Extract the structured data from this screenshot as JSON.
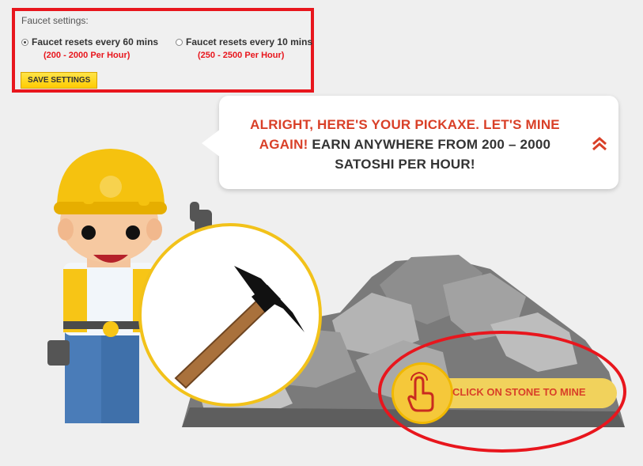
{
  "settings": {
    "title": "Faucet settings:",
    "option1": {
      "label": "Faucet resets every 60 mins",
      "rate": "(200 - 2000 Per Hour)",
      "selected": true
    },
    "option2": {
      "label": "Faucet resets every 10 mins",
      "rate": "(250 - 2500 Per Hour)",
      "selected": false
    },
    "save_label": "SAVE SETTINGS"
  },
  "bubble": {
    "highlight": "ALRIGHT, HERE'S YOUR PICKAXE. LET'S MINE AGAIN!",
    "text": "EARN ANYWHERE FROM 200 – 2000 SATOSHI PER HOUR!",
    "collapse_icon": "double-chevron-up-icon"
  },
  "mine_button": {
    "label": "CLICK ON STONE TO MINE",
    "icon": "hand-pointer-icon"
  },
  "colors": {
    "accent_red": "#e8161d",
    "text_red": "#d94028",
    "yellow": "#f5c83a",
    "background": "#efefef"
  }
}
